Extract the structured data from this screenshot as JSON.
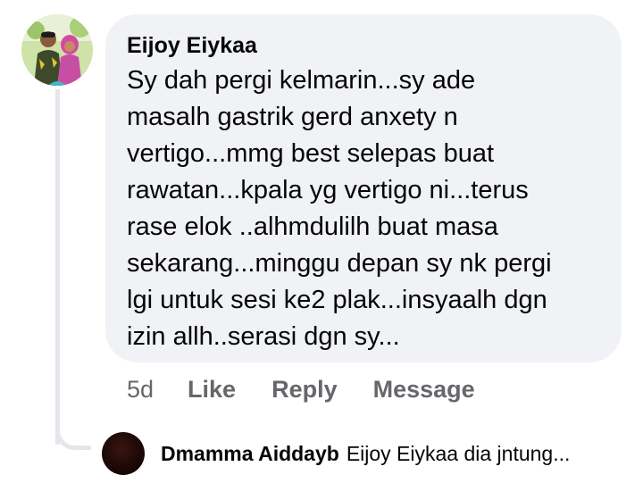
{
  "comment": {
    "author": "Eijoy Eiykaa",
    "lines": [
      "Sy dah pergi kelmarin...sy ade",
      "masalh gastrik gerd anxety n",
      "vertigo...mmg best selepas buat",
      "rawatan...kpala yg vertigo ni...terus",
      "rase elok ..alhmdulilh buat masa",
      "sekarang...minggu depan sy nk pergi",
      "lgi untuk sesi ke2 plak...insyaalh dgn",
      "izin allh..serasi dgn sy..."
    ],
    "avatar_icon": "profile-photo-couple"
  },
  "actions": {
    "timestamp": "5d",
    "like": "Like",
    "reply": "Reply",
    "message": "Message"
  },
  "reply_preview": {
    "author": "Dmamma Aiddayb",
    "snippet": "Eijoy Eiykaa dia jntung...",
    "avatar_icon": "profile-photo-dark"
  },
  "colors": {
    "bubble_bg": "#f0f2f5",
    "meta_text": "#65676b",
    "thread_line": "#e4e6eb",
    "text": "#050505"
  }
}
